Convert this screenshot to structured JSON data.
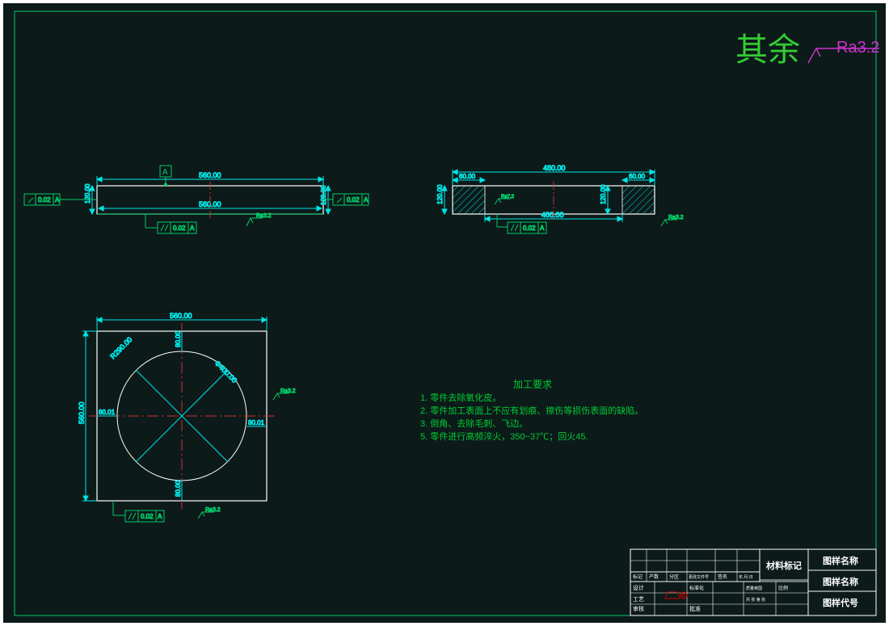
{
  "frame": {
    "color": "#00cc66"
  },
  "surface_note": {
    "text": "其余",
    "ra": "Ra3.2",
    "color_text": "#33cc33",
    "color_ra": "#cc33cc"
  },
  "view_top": {
    "dim_length": "560.00",
    "dim_inner_length": "560.00",
    "dim_height_left": "120.00",
    "dim_height_right": "120.00",
    "datum": "A",
    "tol_flat": "0.02",
    "tol_datum": "A",
    "surf_ra": "Ra3.2"
  },
  "view_side": {
    "dim_length": "480.00",
    "dim_left_gap": "60.00",
    "dim_right_gap": "60.00",
    "dim_height": "120.00",
    "dim_inner_length": "400.00",
    "surf_ra_small": "Ra7.2",
    "surf_ra": "Ra3.2",
    "tol_par": "0.02",
    "tol_par_datum": "A"
  },
  "view_plan": {
    "dim_width": "560.00",
    "dim_height": "560.00",
    "diag_R": "R290.00",
    "diag_diam": "Φ400.00",
    "gap_top": "80.00",
    "gap_bottom": "80.00",
    "gap_left": "80.01",
    "gap_right": "80.01",
    "tol_par": "0.02",
    "tol_par_datum": "A",
    "surf_ra_top": "Ra3.2",
    "surf_ra_bottom": "Ra3.2"
  },
  "requirements": {
    "title": "加工要求",
    "items": [
      "1. 零件去除氧化皮。",
      "2. 零件加工表面上不应有划痕、擦伤等损伤表面的缺陷。",
      "3. 倒角、去除毛刺、飞边。",
      "5. 零件进行高频淬火，350~37℃；回火45."
    ]
  },
  "title_block": {
    "material": "材料标记",
    "name_top": "图样名称",
    "name_mid": "图样名称",
    "code": "图样代号",
    "row_labels": [
      "标记",
      "产数",
      "分区",
      "更改文件号",
      "签名",
      "年.月.日"
    ],
    "col_left": [
      "设计",
      "审核",
      "工艺"
    ],
    "col_mid": [
      "标准化",
      "批准"
    ],
    "col_right": [
      "质量英国",
      "比例",
      "共 张 第 张"
    ]
  }
}
